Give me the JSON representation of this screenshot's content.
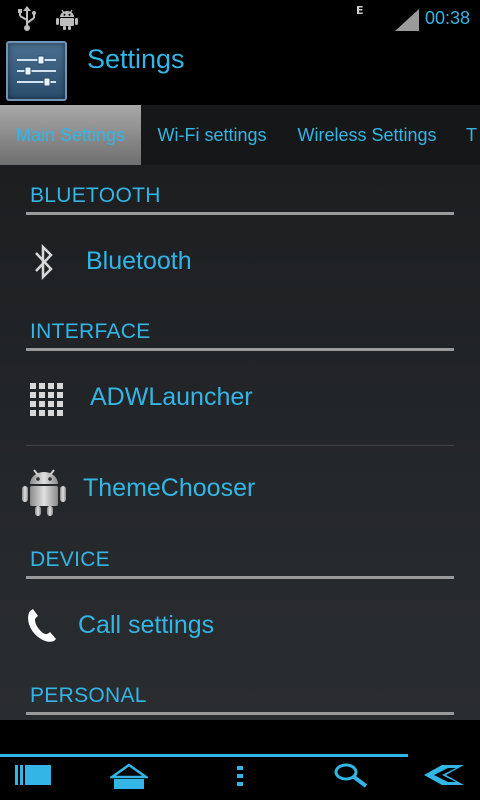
{
  "status_bar": {
    "network_type": "E",
    "time": "00:38",
    "icons": [
      "usb-icon",
      "android-debug-icon",
      "signal-strength-icon"
    ]
  },
  "title_bar": {
    "title": "Settings",
    "icon": "settings-sliders-icon"
  },
  "tabs": [
    {
      "label": "Main Settings",
      "active": true
    },
    {
      "label": "Wi-Fi settings",
      "active": false
    },
    {
      "label": "Wireless Settings",
      "active": false
    },
    {
      "label": "T",
      "active": false
    }
  ],
  "sections": [
    {
      "header": "BLUETOOTH",
      "items": [
        {
          "label": "Bluetooth",
          "icon": "bluetooth-icon"
        }
      ]
    },
    {
      "header": "INTERFACE",
      "items": [
        {
          "label": "ADWLauncher",
          "icon": "app-grid-icon"
        },
        {
          "label": "ThemeChooser",
          "icon": "android-robot-icon"
        }
      ]
    },
    {
      "header": "DEVICE",
      "items": [
        {
          "label": "Call settings",
          "icon": "phone-handset-icon"
        }
      ]
    },
    {
      "header": "PERSONAL",
      "items": []
    }
  ],
  "nav_bar": {
    "buttons": [
      "recent-apps-icon",
      "home-icon",
      "menu-icon",
      "search-icon",
      "back-icon"
    ]
  },
  "colors": {
    "accent": "#33b5e5",
    "background": "#000000",
    "divider": "#9a9a9a"
  }
}
